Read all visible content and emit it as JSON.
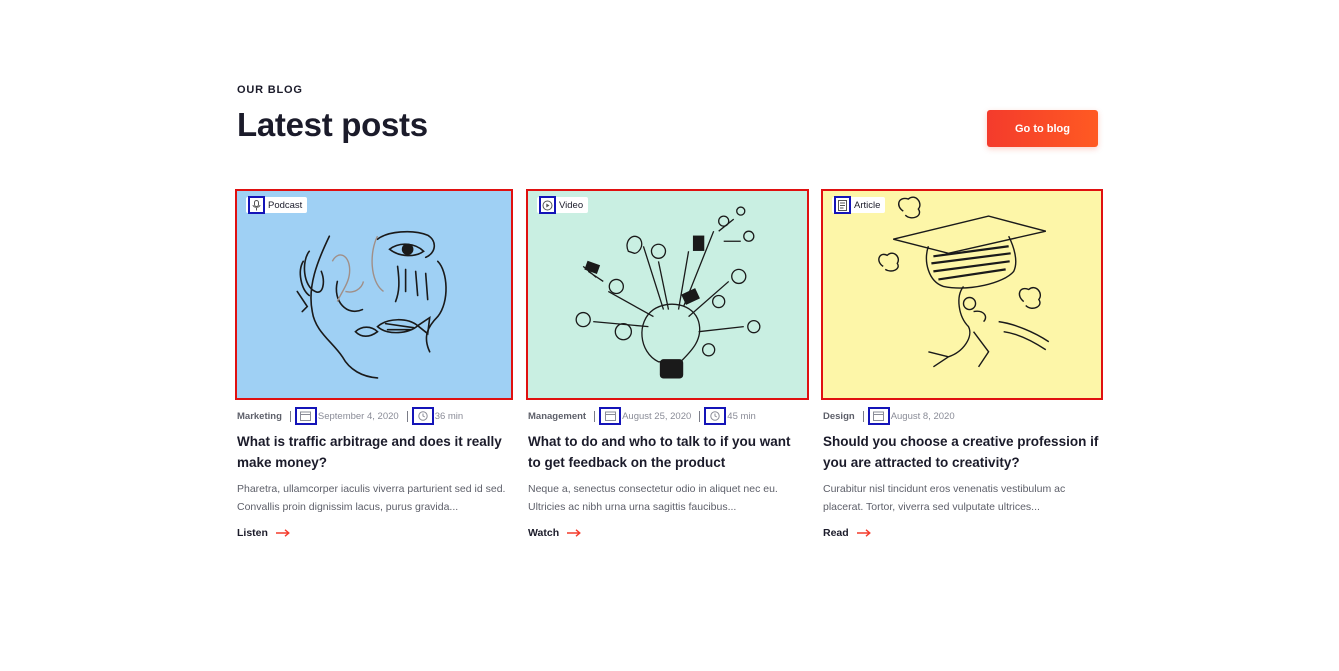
{
  "section": {
    "eyebrow": "OUR BLOG",
    "title": "Latest posts",
    "cta_label": "Go to blog"
  },
  "colors": {
    "accent": "#f43b2c",
    "title": "#1b1b2a",
    "card1_bg": "#9fd0f4",
    "card2_bg": "#c9efe2",
    "card3_bg": "#fdf6a8"
  },
  "posts": [
    {
      "type": "Podcast",
      "type_icon": "microphone-icon",
      "category": "Marketing",
      "date": "September 4, 2020",
      "duration": "36 min",
      "title": "What is traffic arbitrage and does it really make money?",
      "excerpt": "Pharetra, ullamcorper iaculis viverra parturient sed id sed. Convallis proin dignissim lacus, purus gravida...",
      "action": "Listen"
    },
    {
      "type": "Video",
      "type_icon": "play-circle-icon",
      "category": "Management",
      "date": "August 25, 2020",
      "duration": "45 min",
      "title": "What to do and who to talk to if you want to get feedback on the product",
      "excerpt": "Neque a, senectus consectetur odio in aliquet nec eu. Ultricies ac nibh urna urna sagittis faucibus...",
      "action": "Watch"
    },
    {
      "type": "Article",
      "type_icon": "document-icon",
      "category": "Design",
      "date": "August 8, 2020",
      "title": "Should you choose a creative profession if you are attracted to creativity?",
      "excerpt": "Curabitur nisl tincidunt eros venenatis vestibulum ac placerat. Tortor, viverra sed vulputate ultrices...",
      "action": "Read"
    }
  ]
}
